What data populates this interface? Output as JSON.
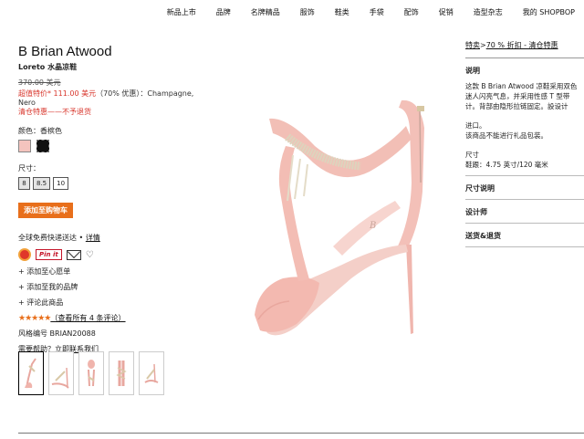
{
  "nav": [
    "新品上市",
    "品牌",
    "名牌精品",
    "服饰",
    "鞋类",
    "手袋",
    "配饰",
    "促销",
    "造型杂志",
    "我的 SHOPBOP"
  ],
  "product": {
    "brand": "B Brian Atwood",
    "name": "Loreto 水晶凉鞋",
    "original_price": "370.00 美元",
    "sale_prefix": "超值特价* 111.00 美元",
    "sale_suffix": "（70% 优惠）：Champagne, Nero",
    "final_sale": "清仓特惠——不予退货",
    "color_label": "颜色：香槟色",
    "size_label": "尺寸：",
    "sizes": [
      "8",
      "8.5",
      "10"
    ],
    "add_to_bag": "添加至购物车",
    "shipping": "全球免费快递送达 • ",
    "shipping_link": "详情",
    "pinit": "Pin it",
    "heart": "♡",
    "add_wishlist": "+ 添加至心愿单",
    "add_brands": "+ 添加至我的品牌",
    "review_product": "+ 评论此商品",
    "stars": "★★★★★",
    "reviews_link": "（查看所有 4 条评论）",
    "style_number": "风格编号 BRIAN20088",
    "help_prefix": "需要帮助？",
    "help_link": "立即联系我们"
  },
  "right": {
    "promo_link1": "特卖",
    "promo_sep": ">",
    "promo_link2": "70 % 折扣 - 清仓特惠",
    "description_title": "说明",
    "description_lines": [
      "这款 B Brian Atwood 凉鞋采用双色",
      "迷人闪亮气息，并采用性感 T 型带",
      "计。背部由隐形拉链固定。設设计"
    ],
    "import_line": "进口。",
    "gift_line": "该商品不能进行礼品包装。",
    "size_heading": "尺寸",
    "heel_line": "鞋跟：4.75 英寸/120 毫米",
    "size_chart": "尺寸说明",
    "designer": "设计师",
    "shipping_returns": "送货&退货"
  },
  "colors": {
    "accent": "#e86f1b",
    "sale_red": "#d8362c",
    "swatch_champagne": "#f4c4be"
  }
}
